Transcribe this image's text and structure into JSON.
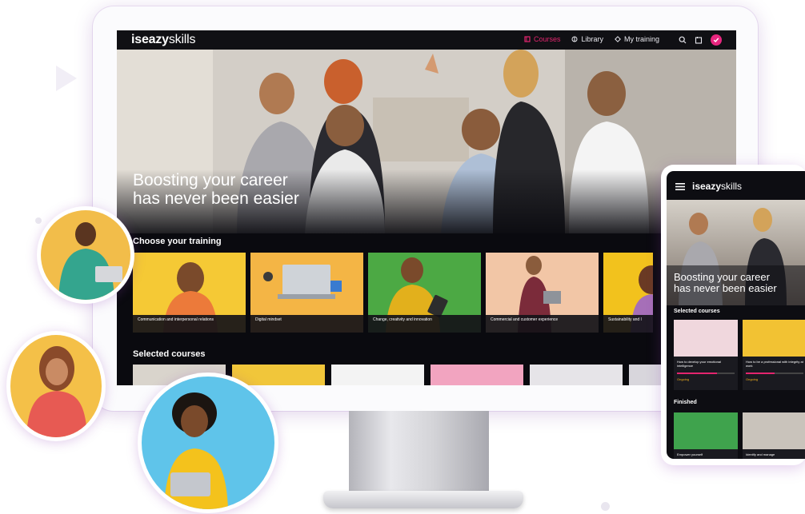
{
  "app": {
    "logo_bold": "iseazy",
    "logo_light": "skills"
  },
  "nav": {
    "items": [
      {
        "label": "Courses",
        "icon": "courses-icon",
        "active": true
      },
      {
        "label": "Library",
        "icon": "library-icon",
        "active": false
      },
      {
        "label": "My training",
        "icon": "training-icon",
        "active": false
      }
    ],
    "icons": [
      "search-icon",
      "bookmark-icon",
      "notifications-check-icon"
    ]
  },
  "hero": {
    "title_line1": "Boosting your career",
    "title_line2": "has never been easier"
  },
  "training": {
    "title": "Choose your training",
    "cards": [
      {
        "label": "Communication and interpersonal relations",
        "bg": "#f5c935"
      },
      {
        "label": "Digital mindset",
        "bg": "#f4b545"
      },
      {
        "label": "Change, creativity and innovation",
        "bg": "#4ca944"
      },
      {
        "label": "Commercial and customer experience",
        "bg": "#f2c6a6"
      },
      {
        "label": "Sustainability and l",
        "bg": "#f2c21d"
      }
    ]
  },
  "selected": {
    "title": "Selected courses",
    "thumb_colors": [
      "#d9d4cc",
      "#f1c63a",
      "#f3f3f3",
      "#f2a4c0",
      "#e6e4e8",
      "#d8d6dc"
    ]
  },
  "phone": {
    "logo_bold": "iseazy",
    "logo_light": "skills",
    "hero_line1": "Boosting your career",
    "hero_line2": "has never been easier",
    "selected_title": "Selected courses",
    "finished_title": "Finished",
    "courses": [
      {
        "label": "How to develop your emotional intelligence",
        "status": "Ongoing"
      },
      {
        "label": "How to be a professional with integrity at work",
        "status": "Ongoing"
      }
    ],
    "finished": [
      {
        "label": "Empower yourself"
      },
      {
        "label": "Identify and manage"
      }
    ]
  },
  "colors": {
    "accent": "#e3246e",
    "badge": "#e7267f",
    "screen_bg": "#0a0a0f"
  }
}
